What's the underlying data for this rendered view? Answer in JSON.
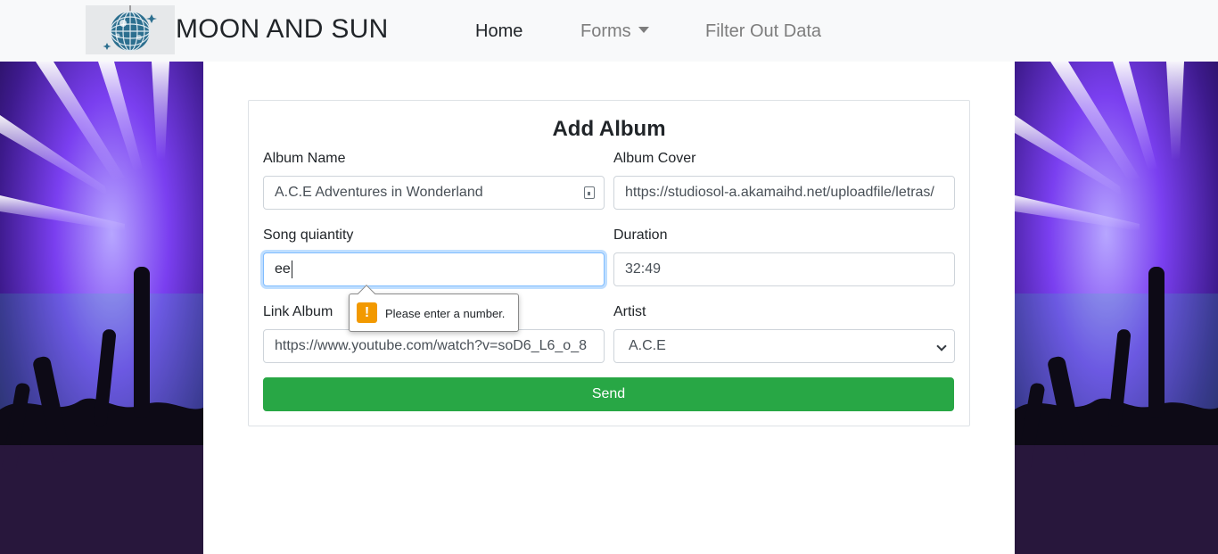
{
  "brand": {
    "name": "MOON AND SUN",
    "logo_icon": "disco-ball-icon"
  },
  "nav": {
    "items": [
      {
        "label": "Home",
        "active": true
      },
      {
        "label": "Forms",
        "dropdown": true
      },
      {
        "label": "Filter Out Data"
      }
    ]
  },
  "form": {
    "title": "Add Album",
    "album_name": {
      "label": "Album Name",
      "value": "A.C.E Adventures in Wonderland"
    },
    "album_cover": {
      "label": "Album Cover",
      "value": "https://studiosol-a.akamaihd.net/uploadfile/letras/"
    },
    "song_quantity": {
      "label": "Song quiantity",
      "value": "ee"
    },
    "duration": {
      "label": "Duration",
      "value": "32:49"
    },
    "link_album": {
      "label": "Link Album",
      "value": "https://www.youtube.com/watch?v=soD6_L6_o_8"
    },
    "artist": {
      "label": "Artist",
      "value": "A.C.E"
    },
    "send_label": "Send"
  },
  "validation": {
    "message": "Please enter a number.",
    "icon": "warning-icon"
  },
  "colors": {
    "primary_button": "#28a745",
    "focus_border": "#80bdff",
    "warning": "#f29900",
    "navbar_bg": "#f8f9fa"
  }
}
